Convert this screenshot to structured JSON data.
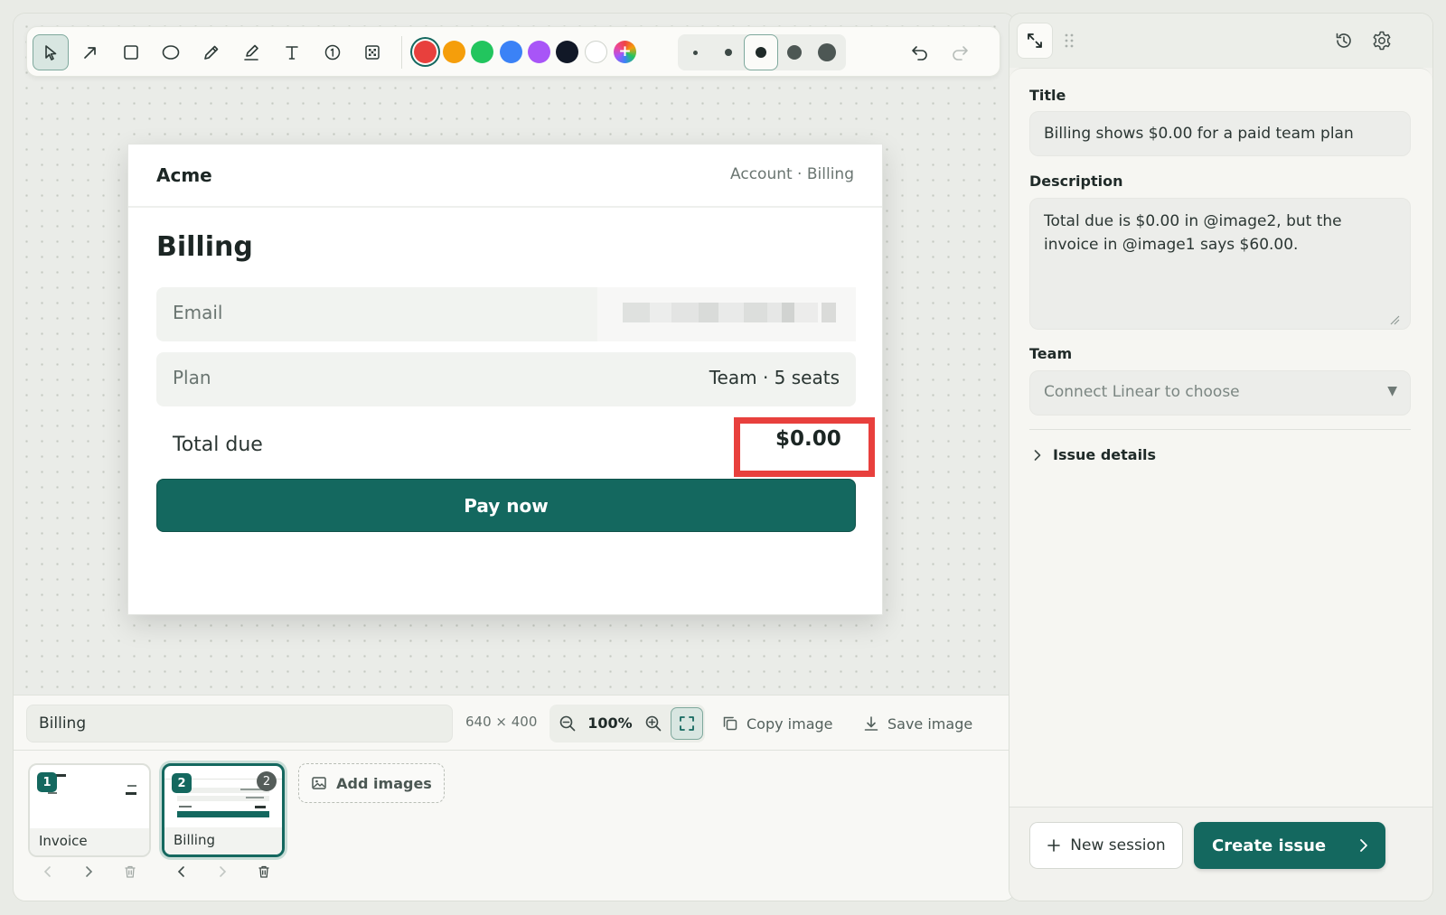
{
  "toolbar": {
    "tools": [
      {
        "id": "select",
        "icon": "cursor-icon"
      },
      {
        "id": "arrow",
        "icon": "arrow-icon"
      },
      {
        "id": "rectangle",
        "icon": "rectangle-icon"
      },
      {
        "id": "ellipse",
        "icon": "ellipse-icon"
      },
      {
        "id": "pen",
        "icon": "pencil-icon"
      },
      {
        "id": "highlighter",
        "icon": "highlighter-icon"
      },
      {
        "id": "text",
        "icon": "text-icon"
      },
      {
        "id": "step-number",
        "icon": "numbered-step-icon"
      },
      {
        "id": "pixelate",
        "icon": "pixelate-icon"
      }
    ],
    "active_tool": "select",
    "colors": [
      "#e8403d",
      "#f59e0b",
      "#22c55e",
      "#3b82f6",
      "#a855f7",
      "#111827",
      "#ffffff"
    ],
    "selected_color": "#e8403d",
    "custom_color_icon": "color-picker-icon",
    "stroke_sizes": [
      "xs",
      "s",
      "m",
      "l",
      "xl"
    ],
    "selected_stroke_size": "m"
  },
  "canvas": {
    "brand": "Acme",
    "breadcrumb": "Account · Billing",
    "heading": "Billing",
    "email_label": "Email",
    "plan_label": "Plan",
    "plan_value": "Team · 5 seats",
    "total_label": "Total due",
    "total_value": "$0.00",
    "pay_button": "Pay now"
  },
  "image_bar": {
    "image_name": "Billing",
    "dimensions": "640 × 400",
    "zoom": "100%",
    "copy_label": "Copy image",
    "save_label": "Save image"
  },
  "thumbnails": [
    {
      "index": "1",
      "label": "Invoice",
      "selected": false
    },
    {
      "index": "2",
      "label": "Billing",
      "selected": true,
      "annotation_count": "2"
    }
  ],
  "add_images_label": "Add images",
  "issue": {
    "title_label": "Title",
    "title_value": "Billing shows $0.00 for a paid team plan",
    "description_label": "Description",
    "description_value": "Total due is $0.00 in @image2, but the invoice in @image1 says $60.00.",
    "team_label": "Team",
    "team_placeholder": "Connect Linear to choose",
    "details_label": "Issue details"
  },
  "footer": {
    "new_session": "New session",
    "create_issue": "Create issue"
  },
  "colors": {
    "brand": "#14685f",
    "highlight_box": "#e8403d"
  }
}
